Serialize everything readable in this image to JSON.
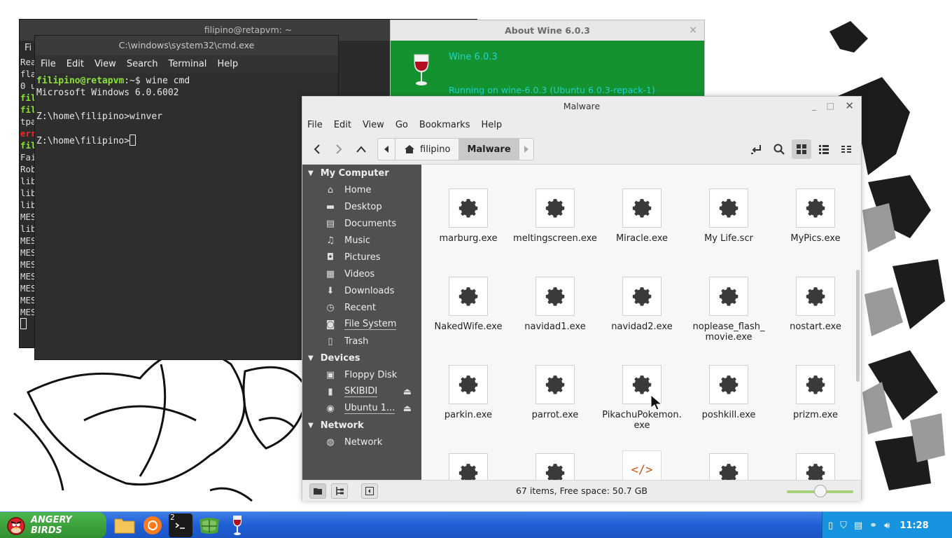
{
  "term_back": {
    "title": "filipino@retapvm: ~",
    "menu_first": "Fi",
    "lines": [
      "Rea",
      "fla",
      "0 u",
      "fil",
      "fil",
      "tpa",
      "err",
      "fil",
      "Fai",
      "Rob",
      "lib",
      "lib",
      "lib",
      "MES",
      "lib",
      "MES",
      "MES",
      "MES",
      "MES",
      "MES",
      "MES",
      "MES"
    ]
  },
  "term_front": {
    "title": "C:\\windows\\system32\\cmd.exe",
    "menu": [
      "File",
      "Edit",
      "View",
      "Search",
      "Terminal",
      "Help"
    ],
    "prompt_user": "filipino@retapvm",
    "prompt_rest": ":~$ wine cmd",
    "line2": "Microsoft Windows 6.0.6002",
    "line4": "Z:\\home\\filipino>winver",
    "line6": "Z:\\home\\filipino>"
  },
  "about_wine": {
    "title": "About Wine 6.0.3",
    "name": "Wine 6.0.3",
    "running": "Running on wine-6.0.3 (Ubuntu 6.0.3-repack-1)",
    "close": "×"
  },
  "nemo": {
    "title": "Malware",
    "menu": [
      "File",
      "Edit",
      "View",
      "Go",
      "Bookmarks",
      "Help"
    ],
    "crumbs": {
      "home": "filipino",
      "current": "Malware"
    },
    "sidebar": {
      "my_computer": "My Computer",
      "places": [
        "Home",
        "Desktop",
        "Documents",
        "Music",
        "Pictures",
        "Videos",
        "Downloads",
        "Recent",
        "File System",
        "Trash"
      ],
      "devices": "Devices",
      "device_items": [
        "Floppy Disk",
        "SKIBIDI",
        "Ubuntu 1..."
      ],
      "network": "Network",
      "network_items": [
        "Network"
      ]
    },
    "files": [
      "marburg.exe",
      "meltingscreen.exe",
      "Miracle.exe",
      "My Life.scr",
      "MyPics.exe",
      "NakedWife.exe",
      "navidad1.exe",
      "navidad2.exe",
      "noplease_flash_ movie.exe",
      "nostart.exe",
      "parkin.exe",
      "parrot.exe",
      "PikachuPokemon. exe",
      "poshkill.exe",
      "prizm.exe"
    ],
    "status": "67 items, Free space: 50.7 GB",
    "zoom_percent": 50
  },
  "taskbar": {
    "start_label": "ANGERY BIRDS",
    "terminal_badge": "2",
    "clock": "11:28"
  },
  "colors": {
    "wine_green": "#13922f",
    "taskbar_blue": "#1f5fd6",
    "start_green": "#3aa53a"
  }
}
